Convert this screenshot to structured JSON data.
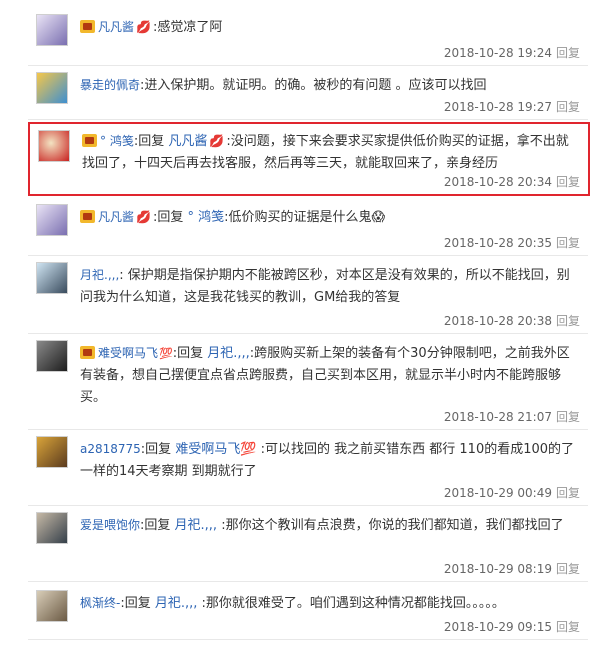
{
  "replies": [
    {
      "user": "凡凡酱",
      "segments": [
        {
          "t": "plain",
          "v": ":感觉凉了阿"
        }
      ],
      "time": "2018-10-28 19:24",
      "reply_label": "回复",
      "avatar_colors": [
        "#7a6fb0",
        "#e9e3f5"
      ]
    },
    {
      "user": "暴走的佩奇",
      "segments": [
        {
          "t": "plain",
          "v": ":进入保护期。就证明。的确。被秒的有问题 。应该可以找回"
        }
      ],
      "time": "2018-10-28 19:27",
      "reply_label": "回复",
      "avatar_colors": [
        "#3e8fd0",
        "#f5c74a"
      ]
    },
    {
      "user": "° 鸿笺",
      "segments": [
        {
          "t": "plain",
          "v": ":回复 "
        },
        {
          "t": "at",
          "v": "凡凡酱"
        },
        {
          "t": "plain",
          "v": ":没问题，接下来会要求买家提供低价购买的证据，拿不出就找回了，十四天后再去找客服，然后再等三天，就能取回来了，亲身经历"
        }
      ],
      "time": "2018-10-28 20:34",
      "reply_label": "回复",
      "avatar_colors": [
        "#c8201f",
        "#f3e3c2"
      ]
    },
    {
      "user": "凡凡酱",
      "segments": [
        {
          "t": "plain",
          "v": ":回复 "
        },
        {
          "t": "at",
          "v": "° 鸿笺"
        },
        {
          "t": "plain",
          "v": ":低价购买的证据是什么鬼😱"
        }
      ],
      "time": "2018-10-28 20:35",
      "reply_label": "回复",
      "avatar_colors": [
        "#7a6fb0",
        "#e9e3f5"
      ]
    },
    {
      "user": "月祀.,,,",
      "segments": [
        {
          "t": "plain",
          "v": ": 保护期是指保护期内不能被跨区秒，对本区是没有效果的，所以不能找回，别问我为什么知道，这是我花钱买的教训，GM给我的答复"
        }
      ],
      "time": "2018-10-28 20:38",
      "reply_label": "回复",
      "avatar_colors": [
        "#3a4c5e",
        "#cfe4f2"
      ]
    },
    {
      "user": "难受啊马飞",
      "level": "💯",
      "segments": [
        {
          "t": "plain",
          "v": ":回复 "
        },
        {
          "t": "at",
          "v": "月祀.,,,"
        },
        {
          "t": "plain",
          "v": ":跨服购买新上架的装备有个30分钟限制吧，之前我外区有装备，想自己摆便宜点省点跨服费，自己买到本区用，就显示半小时内不能跨服够买。"
        }
      ],
      "time": "2018-10-28 21:07",
      "reply_label": "回复",
      "avatar_colors": [
        "#1d1d1d",
        "#8a8a8a"
      ]
    },
    {
      "user": "a2818775",
      "segments": [
        {
          "t": "plain",
          "v": ":回复 "
        },
        {
          "t": "at",
          "v": "难受啊马飞💯"
        },
        {
          "t": "plain",
          "v": " :可以找回的 我之前买错东西 都行 110的看成100的了 一样的14天考察期 到期就行了"
        }
      ],
      "time": "2018-10-29 00:49",
      "reply_label": "回复",
      "avatar_colors": [
        "#d9a43a",
        "#5b3b1e"
      ]
    },
    {
      "user": "爱是喂饱你",
      "segments": [
        {
          "t": "plain",
          "v": ":回复 "
        },
        {
          "t": "at",
          "v": "月祀.,,,"
        },
        {
          "t": "plain",
          "v": " :那你这个教训有点浪费，你说的我们都知道，我们都找回了"
        }
      ],
      "time": "2018-10-29 08:19",
      "reply_label": "回复",
      "avatar_colors": [
        "#35404a",
        "#c6b9a6"
      ]
    },
    {
      "user": "枫渐终-",
      "segments": [
        {
          "t": "plain",
          "v": ":回复 "
        },
        {
          "t": "at",
          "v": "月祀.,,,"
        },
        {
          "t": "plain",
          "v": " :那你就很难受了。咱们遇到这种情况都能找回。。。。。"
        }
      ],
      "time": "2018-10-29 09:15",
      "reply_label": "回复",
      "avatar_colors": [
        "#6b5a44",
        "#d8cdb8"
      ]
    }
  ]
}
